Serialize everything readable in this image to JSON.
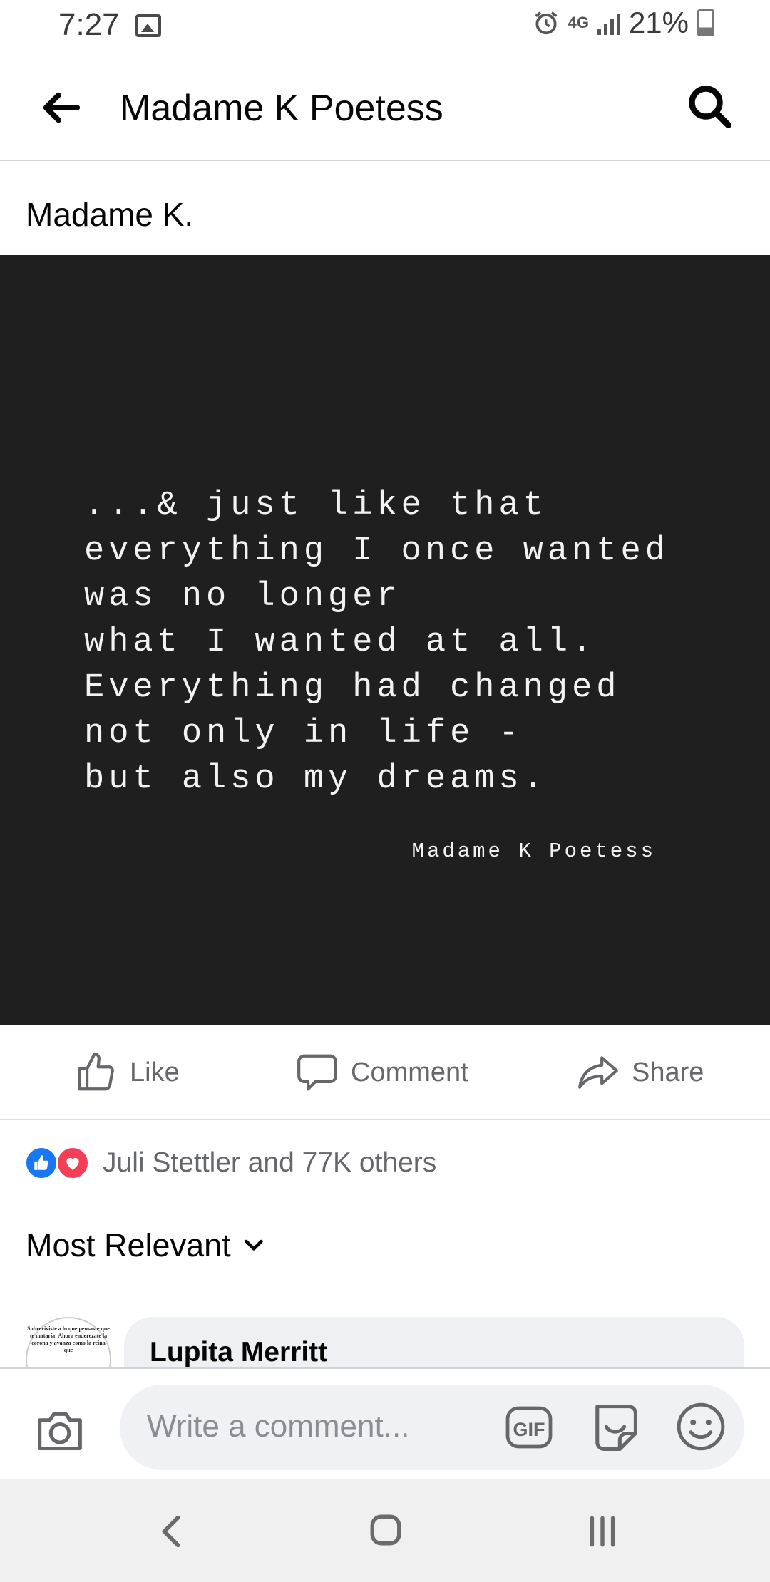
{
  "status_bar": {
    "time": "7:27",
    "network": "4G",
    "battery": "21%"
  },
  "app_bar": {
    "title": "Madame K Poetess"
  },
  "post": {
    "author": "Madame K.",
    "poem_text": "...& just like that\neverything I once wanted\nwas no longer\nwhat I wanted at all.\nEverything had changed\nnot only in life -\nbut also my dreams.",
    "poem_signature": "Madame K Poetess"
  },
  "actions": {
    "like_label": "Like",
    "comment_label": "Comment",
    "share_label": "Share"
  },
  "reactions": {
    "summary": "Juli Stettler and 77K others"
  },
  "comments": {
    "sort_label": "Most Relevant",
    "first_commenter": "Lupita Merritt",
    "first_avatar_text": "Sobreviviste a lo que pensaste que te mataría! Ahora enderezate la corona y avanza como la reina que"
  },
  "composer": {
    "placeholder": "Write a comment..."
  },
  "colors": {
    "poem_background": "#1f1f20",
    "like_blue": "#1877f2",
    "love_red": "#f33e58",
    "secondary_text": "#65676b"
  }
}
